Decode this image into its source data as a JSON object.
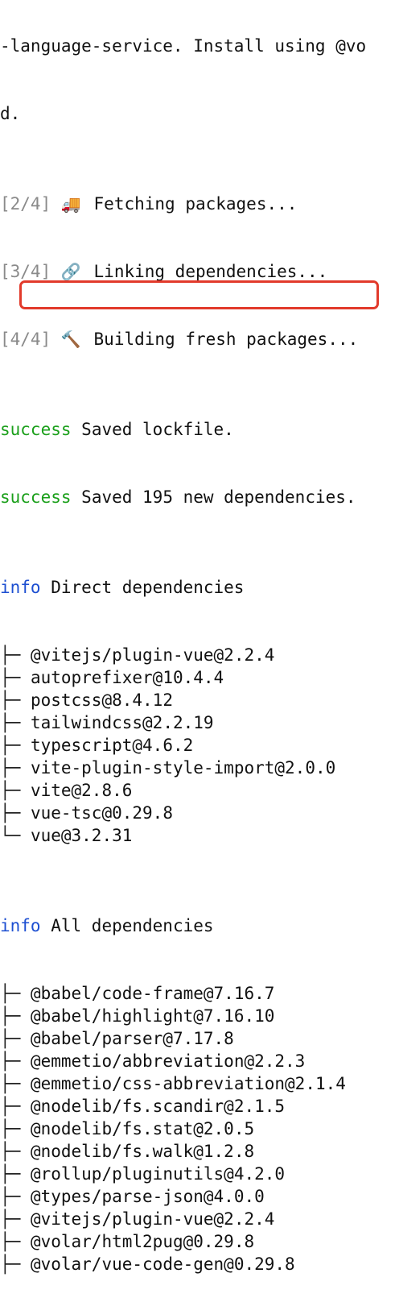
{
  "terminal": {
    "header_lines": [
      "-language-service. Install using @vo",
      "d."
    ],
    "steps": [
      {
        "counter": "[2/4]",
        "icon": "🚚",
        "icon_name": "truck-icon",
        "text": "Fetching packages..."
      },
      {
        "counter": "[3/4]",
        "icon": "🔗",
        "icon_name": "link-icon",
        "text": "Linking dependencies..."
      },
      {
        "counter": "[4/4]",
        "icon": "🔨",
        "icon_name": "hammer-icon",
        "text": "Building fresh packages..."
      }
    ],
    "success_lines": [
      {
        "tag": "success",
        "text": "Saved lockfile."
      },
      {
        "tag": "success",
        "text": "Saved 195 new dependencies."
      }
    ],
    "direct": {
      "tag": "info",
      "text": "Direct dependencies",
      "items": [
        {
          "branch": "├─",
          "pkg": "@vitejs/plugin-vue@2.2.4"
        },
        {
          "branch": "├─",
          "pkg": "autoprefixer@10.4.4"
        },
        {
          "branch": "├─",
          "pkg": "postcss@8.4.12"
        },
        {
          "branch": "├─",
          "pkg": "tailwindcss@2.2.19"
        },
        {
          "branch": "├─",
          "pkg": "typescript@4.6.2"
        },
        {
          "branch": "├─",
          "pkg": "vite-plugin-style-import@2.0.0"
        },
        {
          "branch": "├─",
          "pkg": "vite@2.8.6"
        },
        {
          "branch": "├─",
          "pkg": "vue-tsc@0.29.8"
        },
        {
          "branch": "└─",
          "pkg": "vue@3.2.31"
        }
      ]
    },
    "all": {
      "tag": "info",
      "text": "All dependencies",
      "items": [
        {
          "branch": "├─",
          "pkg": "@babel/code-frame@7.16.7"
        },
        {
          "branch": "├─",
          "pkg": "@babel/highlight@7.16.10"
        },
        {
          "branch": "├─",
          "pkg": "@babel/parser@7.17.8"
        },
        {
          "branch": "├─",
          "pkg": "@emmetio/abbreviation@2.2.3"
        },
        {
          "branch": "├─",
          "pkg": "@emmetio/css-abbreviation@2.1.4"
        },
        {
          "branch": "├─",
          "pkg": "@nodelib/fs.scandir@2.1.5"
        },
        {
          "branch": "├─",
          "pkg": "@nodelib/fs.stat@2.0.5"
        },
        {
          "branch": "├─",
          "pkg": "@nodelib/fs.walk@1.2.8"
        },
        {
          "branch": "├─",
          "pkg": "@rollup/pluginutils@4.2.0"
        },
        {
          "branch": "├─",
          "pkg": "@types/parse-json@4.0.0"
        },
        {
          "branch": "├─",
          "pkg": "@vitejs/plugin-vue@2.2.4"
        },
        {
          "branch": "├─",
          "pkg": "@volar/html2pug@0.29.8"
        },
        {
          "branch": "├─",
          "pkg": "@volar/vue-code-gen@0.29.8"
        }
      ]
    }
  },
  "colors": {
    "success": "#1a9f1a",
    "info": "#1d4fd1",
    "dim": "#8a8a8a",
    "highlight_border": "#e23a2b"
  }
}
